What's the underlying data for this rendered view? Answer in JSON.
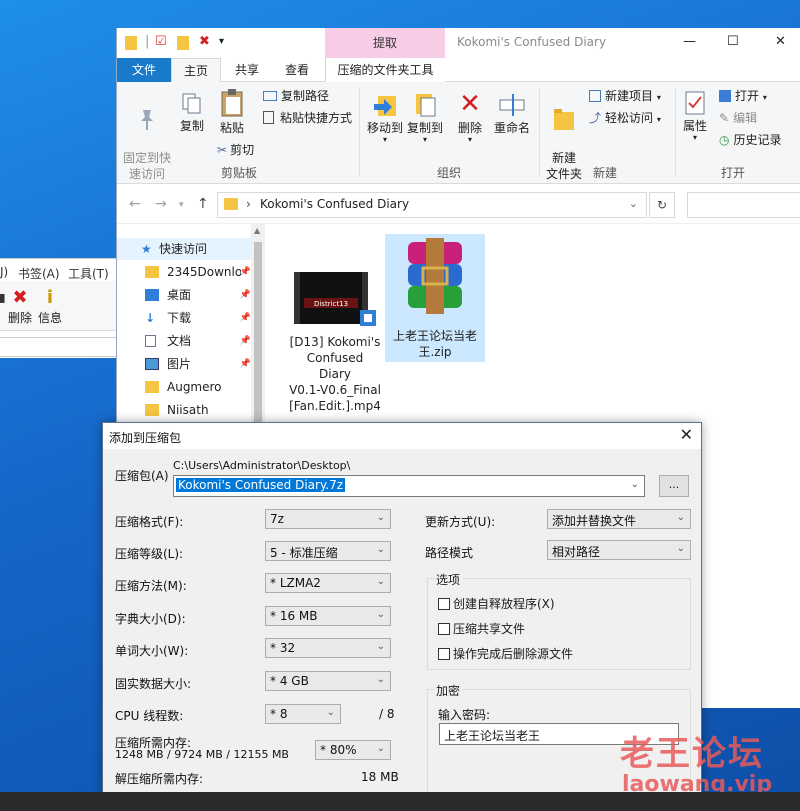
{
  "background_window": {
    "menu": [
      "J)",
      "书签(A)",
      "工具(T)"
    ],
    "toolbar": [
      {
        "label": "",
        "icon": "disk-icon"
      },
      {
        "label": "删除",
        "icon": "delete-icon"
      },
      {
        "label": "信息",
        "icon": "info-icon"
      }
    ]
  },
  "explorer": {
    "title": "Kokomi's Confused Diary",
    "extract_tab": "提取",
    "window_controls": [
      "—",
      "☐",
      "✕"
    ],
    "tabs": {
      "file": "文件",
      "home": "主页",
      "share": "共享",
      "view": "查看",
      "compressed_tools": "压缩的文件夹工具"
    },
    "ribbon": {
      "clipboard": {
        "pin_quick_access": "固定到快\n速访问",
        "copy": "复制",
        "paste": "粘贴",
        "copy_path": "复制路径",
        "paste_shortcut": "粘贴快捷方式",
        "cut": "剪切",
        "group_label": "剪贴板"
      },
      "organize": {
        "move_to": "移动到",
        "copy_to": "复制到",
        "delete": "删除",
        "rename": "重命名",
        "group_label": "组织"
      },
      "new": {
        "new_folder": "新建\n文件夹",
        "new_item": "新建项目",
        "easy_access": "轻松访问",
        "group_label": "新建"
      },
      "open": {
        "properties": "属性",
        "open": "打开",
        "edit": "编辑",
        "history": "历史记录",
        "group_label": "打开"
      }
    },
    "address": {
      "path": "Kokomi's Confused Diary"
    },
    "nav_items": [
      {
        "label": "快速访问",
        "icon": "star-icon",
        "pinned": false,
        "selected": true
      },
      {
        "label": "2345Downlo",
        "icon": "folder-icon",
        "pinned": true,
        "selected": false
      },
      {
        "label": "桌面",
        "icon": "desktop-icon",
        "pinned": true,
        "selected": false
      },
      {
        "label": "下载",
        "icon": "download-icon",
        "pinned": true,
        "selected": false
      },
      {
        "label": "文档",
        "icon": "document-icon",
        "pinned": true,
        "selected": false
      },
      {
        "label": "图片",
        "icon": "picture-icon",
        "pinned": true,
        "selected": false
      },
      {
        "label": "Augmero",
        "icon": "folder-icon",
        "pinned": false,
        "selected": false
      },
      {
        "label": "Niisath",
        "icon": "folder-icon",
        "pinned": false,
        "selected": false
      }
    ],
    "files": [
      {
        "name": "[D13] Kokomi's\nConfused Diary\nV0.1-V0.6_Final\n[Fan.Edit.].mp4",
        "thumb_text": "District13",
        "type": "video"
      },
      {
        "name": "上老王论坛当老\n王.zip",
        "type": "archive"
      }
    ]
  },
  "dialog": {
    "title": "添加到压缩包",
    "archive_label": "压缩包(A)",
    "archive_dir": "C:\\Users\\Administrator\\Desktop\\",
    "archive_name": "Kokomi's Confused Diary.7z",
    "browse": "...",
    "left_fields": [
      {
        "label": "压缩格式(F):",
        "value": "7z"
      },
      {
        "label": "压缩等级(L):",
        "value": "5 - 标准压缩"
      },
      {
        "label": "压缩方法(M):",
        "value": "* LZMA2"
      },
      {
        "label": "字典大小(D):",
        "value": "* 16 MB"
      },
      {
        "label": "单词大小(W):",
        "value": "* 32"
      },
      {
        "label": "固实数据大小:",
        "value": "* 4 GB"
      }
    ],
    "cpu_label": "CPU 线程数:",
    "cpu_value": "* 8",
    "cpu_total": "/ 8",
    "memory_label": "压缩所需内存:",
    "memory_values": "1248 MB / 9724 MB / 12155 MB",
    "memory_percent": "* 80%",
    "decompress_label": "解压缩所需内存:",
    "decompress_value": "18 MB",
    "update_label": "更新方式(U):",
    "update_value": "添加并替换文件",
    "path_label": "路径模式",
    "path_value": "相对路径",
    "options_label": "选项",
    "options": [
      "创建自释放程序(X)",
      "压缩共享文件",
      "操作完成后删除源文件"
    ],
    "encryption_label": "加密",
    "password_label": "输入密码:",
    "password_value": "上老王论坛当老王"
  },
  "watermark": {
    "cn": "老王论坛",
    "en": "laowang.vip"
  },
  "colors": {
    "file_tab": "#1979ca",
    "extract_tab": "#f7cce6",
    "selection": "#0078d7",
    "watermark": "#e75a5a"
  }
}
